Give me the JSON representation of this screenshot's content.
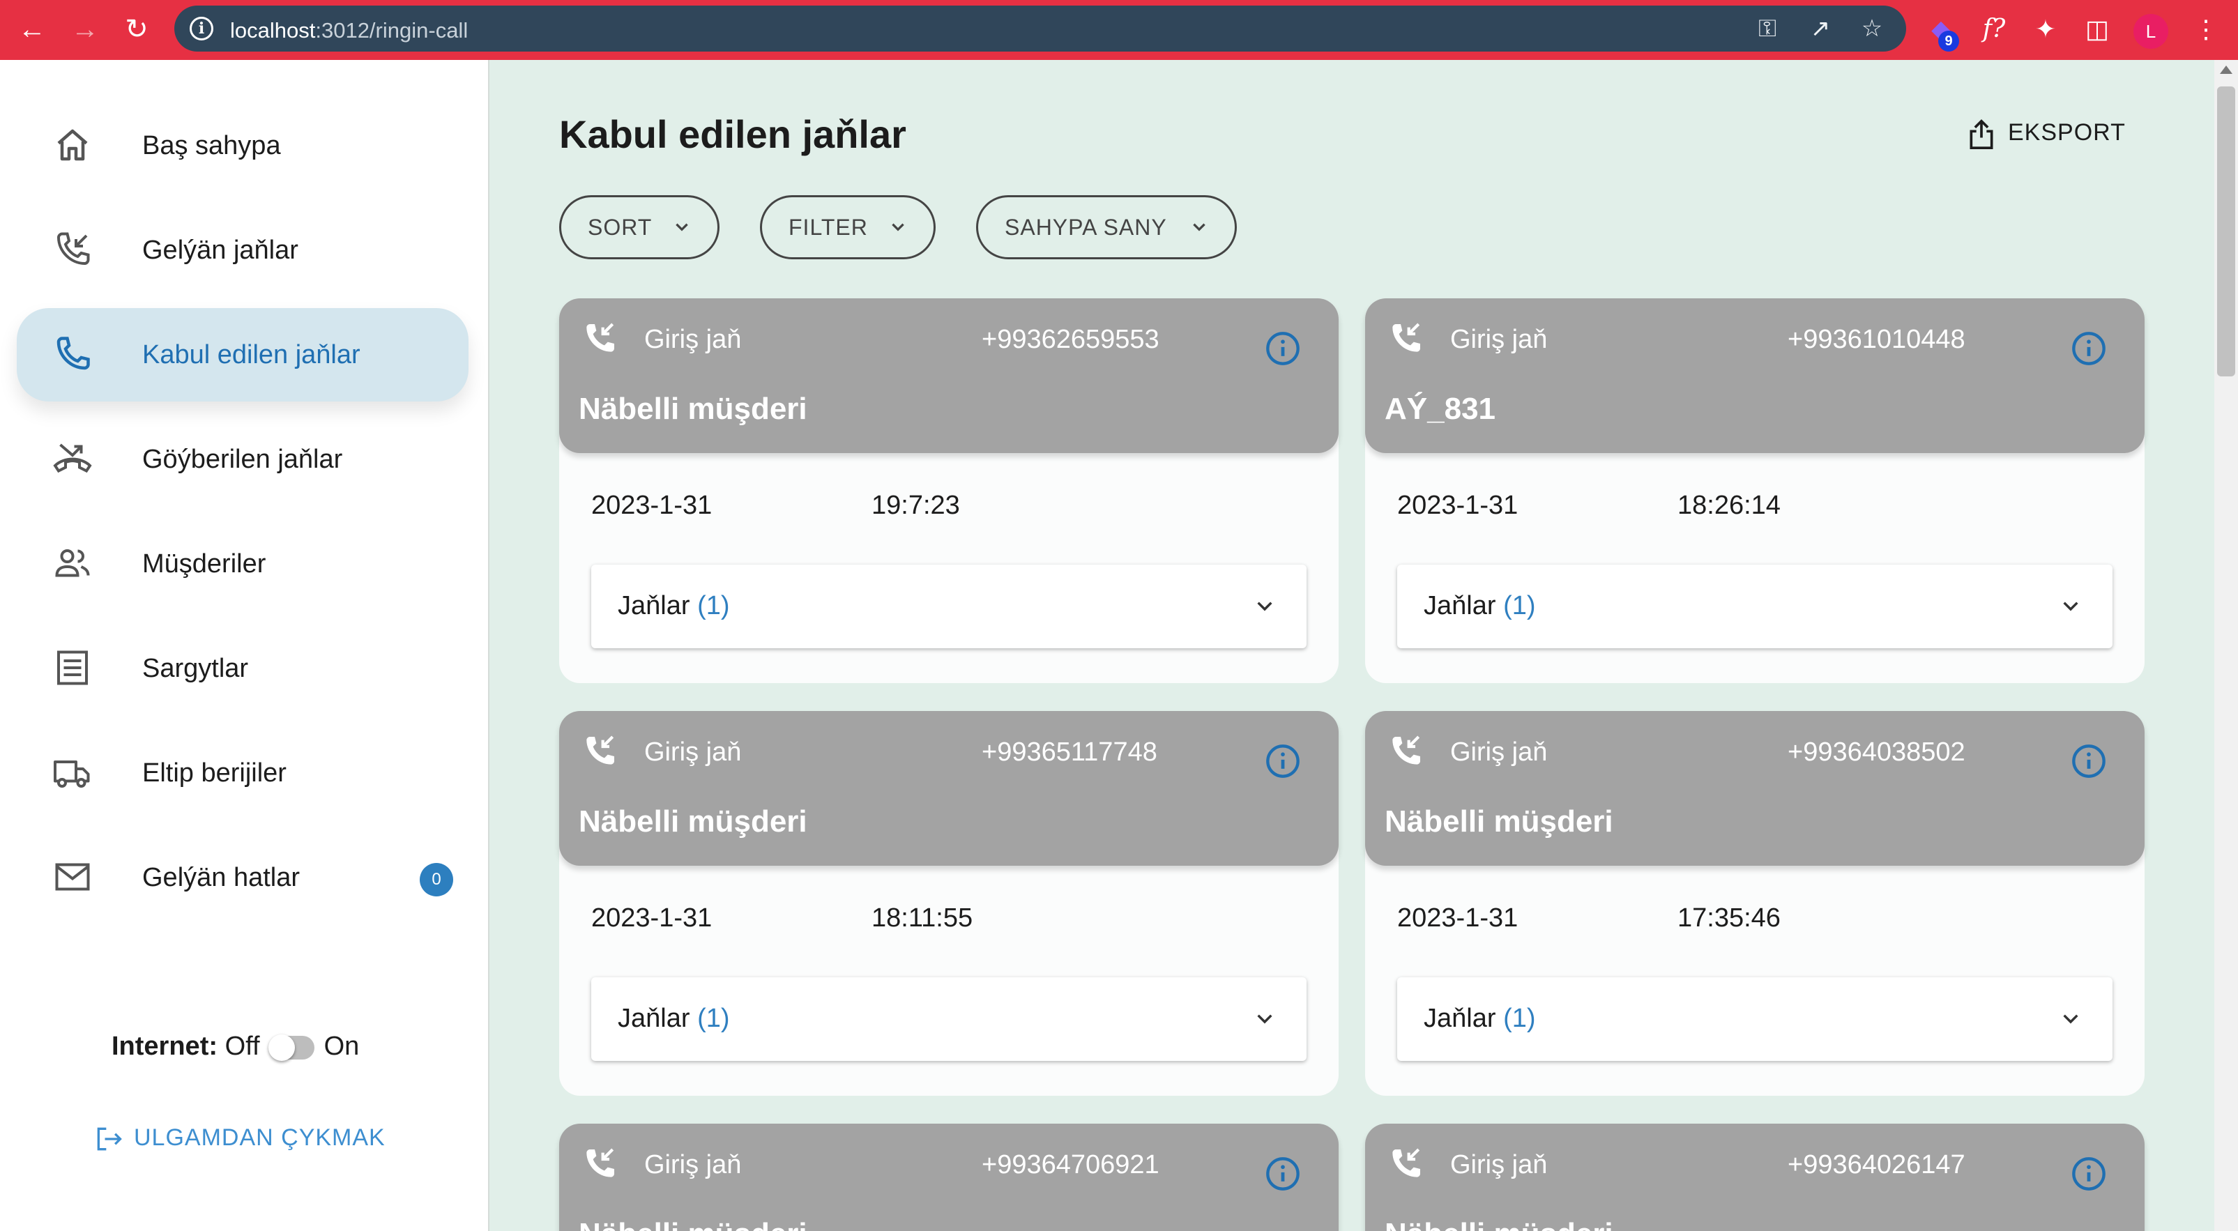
{
  "browser": {
    "url_host": "localhost",
    "url_path": ":3012/ringin-call",
    "extension_badge": "9",
    "profile_initial": "L",
    "ext_font_label": "f?"
  },
  "sidebar": {
    "items": [
      {
        "label": "Baş sahypa",
        "icon": "home-icon"
      },
      {
        "label": "Gelýän jaňlar",
        "icon": "incoming-call-icon"
      },
      {
        "label": "Kabul edilen jaňlar",
        "icon": "phone-icon",
        "active": true
      },
      {
        "label": "Göýberilen jaňlar",
        "icon": "missed-call-icon"
      },
      {
        "label": "Müşderiler",
        "icon": "people-icon"
      },
      {
        "label": "Sargytlar",
        "icon": "receipt-icon"
      },
      {
        "label": "Eltip berijiler",
        "icon": "truck-icon"
      },
      {
        "label": "Gelýän hatlar",
        "icon": "mail-icon",
        "badge": "0"
      }
    ],
    "internet_label": "Internet:",
    "internet_off": "Off",
    "internet_on": "On",
    "logout": "ULGAMDAN ÇYKMAK"
  },
  "main": {
    "title": "Kabul edilen jaňlar",
    "export": "EKSPORT",
    "chips": {
      "sort": "SORT",
      "filter": "FILTER",
      "page_size": "SAHYPA SANY"
    }
  },
  "cards": [
    {
      "type": "Giriş jaň",
      "number": "+99362659553",
      "name": "Näbelli müşderi",
      "date": "2023-1-31",
      "time": "19:7:23",
      "acc_label": "Jaňlar",
      "acc_count": "(1)"
    },
    {
      "type": "Giriş jaň",
      "number": "+99361010448",
      "name": "AÝ_831",
      "date": "2023-1-31",
      "time": "18:26:14",
      "acc_label": "Jaňlar",
      "acc_count": "(1)"
    },
    {
      "type": "Giriş jaň",
      "number": "+99365117748",
      "name": "Näbelli müşderi",
      "date": "2023-1-31",
      "time": "18:11:55",
      "acc_label": "Jaňlar",
      "acc_count": "(1)"
    },
    {
      "type": "Giriş jaň",
      "number": "+99364038502",
      "name": "Näbelli müşderi",
      "date": "2023-1-31",
      "time": "17:35:46",
      "acc_label": "Jaňlar",
      "acc_count": "(1)"
    },
    {
      "type": "Giriş jaň",
      "number": "+99364706921",
      "name": "Näbelli müşderi"
    },
    {
      "type": "Giriş jaň",
      "number": "+99364026147",
      "name": "Näbelli müşderi"
    }
  ],
  "colors": {
    "chrome": "#e63043",
    "accent": "#1f6fb2",
    "card_header": "#a3a3a3",
    "background": "#e1efe9"
  }
}
